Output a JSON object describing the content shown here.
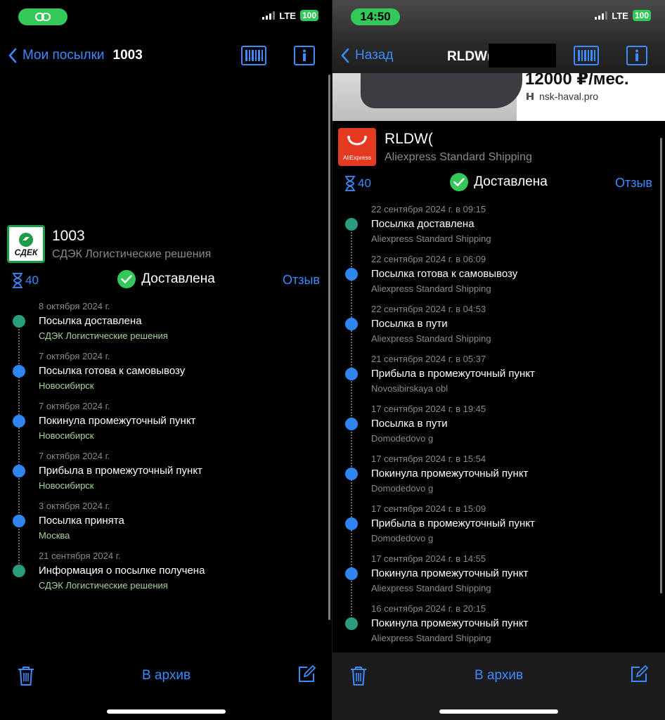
{
  "left": {
    "status": {
      "pill_icon": "link-icon",
      "network": "LTE",
      "battery": "100"
    },
    "nav": {
      "back_label": "Мои посылки",
      "title": "1003"
    },
    "package": {
      "id": "1003",
      "carrier": "СДЭК Логистические решения",
      "logo_text": "СДЕК"
    },
    "summary": {
      "days": "40",
      "status": "Доставлена",
      "review": "Отзыв"
    },
    "events": [
      {
        "date": "8 октября 2024 г.",
        "title": "Посылка доставлена",
        "location": "СДЭК Логистические решения",
        "dot": "green"
      },
      {
        "date": "7 октября 2024 г.",
        "title": "Посылка готова к самовывозу",
        "location": "Новосибирск",
        "dot": "blue"
      },
      {
        "date": "7 октября 2024 г.",
        "title": "Покинула промежуточный пункт",
        "location": "Новосибирск",
        "dot": "blue"
      },
      {
        "date": "7 октября 2024 г.",
        "title": "Прибыла в промежуточный пункт",
        "location": "Новосибирск",
        "dot": "blue"
      },
      {
        "date": "3 октября 2024 г.",
        "title": "Посылка принята",
        "location": "Москва",
        "dot": "blue"
      },
      {
        "date": "21 сентября 2024 г.",
        "title": "Информация о посылке получена",
        "location": "СДЭК Логистические решения",
        "dot": "green"
      }
    ],
    "toolbar": {
      "archive_label": "В архив"
    }
  },
  "right": {
    "status": {
      "time": "14:50",
      "network": "LTE",
      "battery": "100"
    },
    "nav": {
      "back_label": "Назад",
      "title": "RLDW("
    },
    "ad": {
      "price": "12000 ₽/мес.",
      "site": "nsk-haval.pro"
    },
    "package": {
      "id": "RLDW(",
      "carrier": "Aliexpress Standard Shipping",
      "logo_text": "AliExpress"
    },
    "summary": {
      "days": "40",
      "status": "Доставлена",
      "review": "Отзыв"
    },
    "events": [
      {
        "date": "22 сентября 2024 г. в 09:15",
        "title": "Посылка доставлена",
        "location": "Aliexpress Standard Shipping",
        "dot": "green"
      },
      {
        "date": "22 сентября 2024 г. в 06:09",
        "title": "Посылка готова к самовывозу",
        "location": "Aliexpress Standard Shipping",
        "dot": "blue"
      },
      {
        "date": "22 сентября 2024 г. в 04:53",
        "title": "Посылка в пути",
        "location": "Aliexpress Standard Shipping",
        "dot": "blue"
      },
      {
        "date": "21 сентября 2024 г. в 05:37",
        "title": "Прибыла в промежуточный пункт",
        "location": "Novosibirskaya obl",
        "dot": "blue"
      },
      {
        "date": "17 сентября 2024 г. в 19:45",
        "title": "Посылка в пути",
        "location": "Domodedovo g",
        "dot": "blue"
      },
      {
        "date": "17 сентября 2024 г. в 15:54",
        "title": "Покинула промежуточный пункт",
        "location": "Domodedovo g",
        "dot": "blue"
      },
      {
        "date": "17 сентября 2024 г. в 15:09",
        "title": "Прибыла в промежуточный пункт",
        "location": "Domodedovo g",
        "dot": "blue"
      },
      {
        "date": "17 сентября 2024 г. в 14:55",
        "title": "Покинула промежуточный пункт",
        "location": "Aliexpress Standard Shipping",
        "dot": "blue"
      },
      {
        "date": "16 сентября 2024 г. в 20:15",
        "title": "Покинула промежуточный пункт",
        "location": "Aliexpress Standard Shipping",
        "dot": "green"
      }
    ],
    "toolbar": {
      "archive_label": "В архив"
    }
  }
}
